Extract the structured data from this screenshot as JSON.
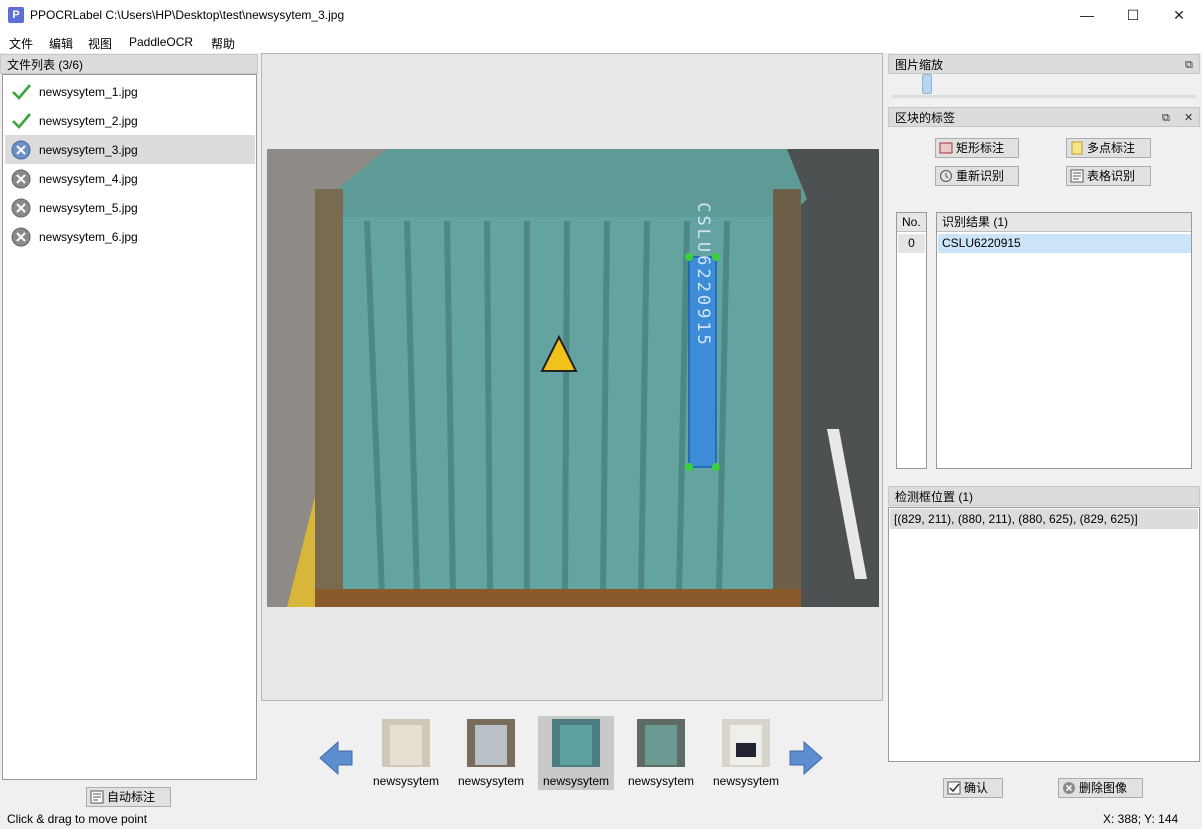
{
  "window": {
    "app_icon_letter": "P",
    "title": "PPOCRLabel C:\\Users\\HP\\Desktop\\test\\newsysytem_3.jpg",
    "minimize": "—",
    "maximize": "☐",
    "close": "✕"
  },
  "menu": [
    "文件",
    "编辑",
    "视图",
    "PaddleOCR",
    "帮助"
  ],
  "file_list": {
    "title": "文件列表 (3/6)",
    "items": [
      {
        "name": "newsysytem_1.jpg",
        "status": "done"
      },
      {
        "name": "newsysytem_2.jpg",
        "status": "done"
      },
      {
        "name": "newsysytem_3.jpg",
        "status": "pending",
        "selected": true
      },
      {
        "name": "newsysytem_4.jpg",
        "status": "pending"
      },
      {
        "name": "newsysytem_5.jpg",
        "status": "pending"
      },
      {
        "name": "newsysytem_6.jpg",
        "status": "pending"
      }
    ],
    "auto_label_button": "自动标注"
  },
  "canvas": {
    "container_text": "CSLU6220915"
  },
  "thumbnails": [
    {
      "label": "newsysytem",
      "selected": false
    },
    {
      "label": "newsysytem",
      "selected": false
    },
    {
      "label": "newsysytem",
      "selected": true
    },
    {
      "label": "newsysytem",
      "selected": false
    },
    {
      "label": "newsysytem",
      "selected": false
    }
  ],
  "zoom_dock": {
    "title": "图片缩放",
    "float_icon": "⧉",
    "zoom_level": 0.02
  },
  "label_dock": {
    "title": "区块的标签",
    "float_icon": "⧉",
    "close_icon": "✕",
    "buttons": {
      "rect": "矩形标注",
      "polygon": "多点标注",
      "re_recognize": "重新识别",
      "table": "表格识别"
    },
    "table": {
      "col_no": "No.",
      "col_result": "识别结果 (1)",
      "rows": [
        {
          "no": "0",
          "result": "CSLU6220915"
        }
      ]
    }
  },
  "box_dock": {
    "title": "检测框位置 (1)",
    "entries": [
      "[(829, 211), (880, 211), (880, 625), (829, 625)]"
    ]
  },
  "actions": {
    "confirm": "确认",
    "delete_image": "删除图像"
  },
  "status": {
    "message": "Click & drag to move point",
    "coords": "X: 388; Y: 144"
  }
}
